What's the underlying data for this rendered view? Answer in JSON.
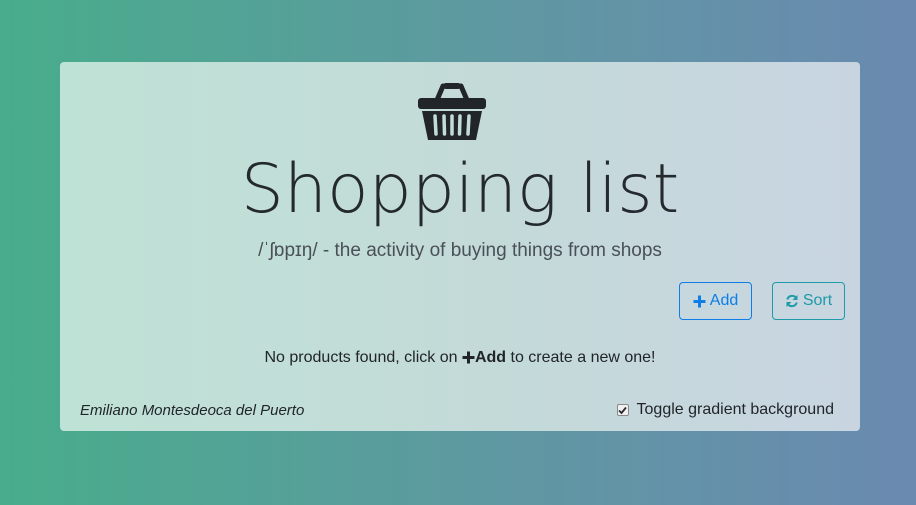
{
  "header": {
    "icon": "shopping-basket-icon",
    "title": "Shopping list",
    "subtitle": "/ˈʃɒpɪŋ/ - the activity of buying things from shops"
  },
  "toolbar": {
    "add_label": "Add",
    "add_icon": "plus-icon",
    "sort_label": "Sort",
    "sort_icon": "refresh-icon"
  },
  "empty_state": {
    "text_before": "No products found, click on",
    "action_label": "Add",
    "text_after": "to create a new one!"
  },
  "footer": {
    "author": "Emiliano Montesdeoca del Puerto",
    "toggle_label": "Toggle gradient background",
    "toggle_checked": true
  },
  "colors": {
    "primary": "#0d7ee8",
    "info": "#1e9aa8"
  }
}
